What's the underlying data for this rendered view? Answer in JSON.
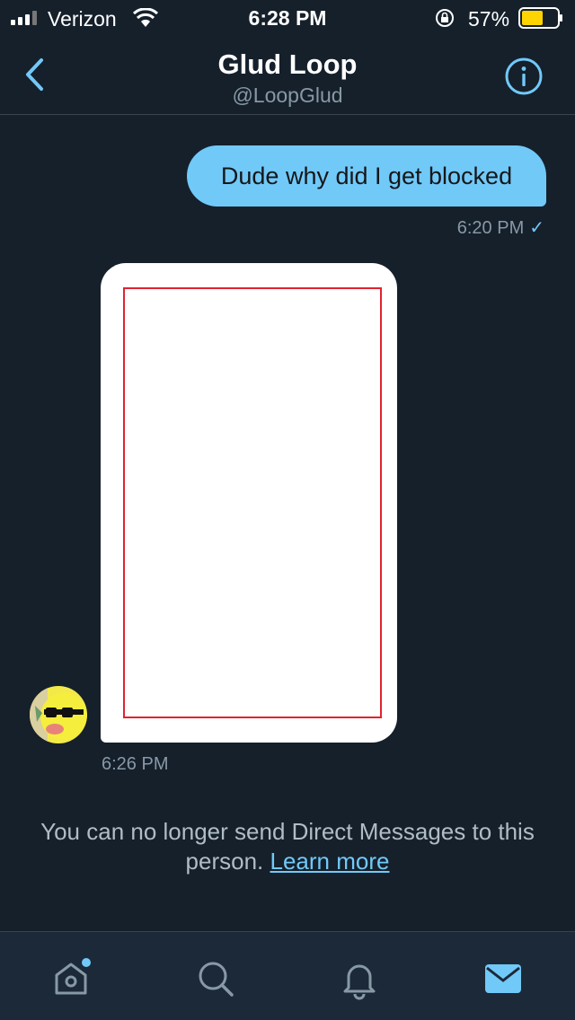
{
  "status_bar": {
    "carrier": "Verizon",
    "time": "6:28 PM",
    "battery": "57%"
  },
  "header": {
    "title": "Glud Loop",
    "handle": "@LoopGlud"
  },
  "messages": [
    {
      "direction": "outgoing",
      "text": "Dude why did I get blocked",
      "time": "6:20 PM",
      "read_mark": "✓"
    },
    {
      "direction": "incoming",
      "type": "media",
      "time": "6:26 PM"
    }
  ],
  "notice": {
    "text": "You can no longer send Direct Messages to this person.",
    "link": "Learn more"
  },
  "colors": {
    "background": "#15202b",
    "accent": "#71c9f8",
    "muted": "#8899a6",
    "battery": "#ffd400"
  },
  "tabbar": {
    "tabs": [
      "home-icon",
      "search-icon",
      "bell-icon",
      "mail-icon"
    ],
    "active": "mail-icon"
  }
}
